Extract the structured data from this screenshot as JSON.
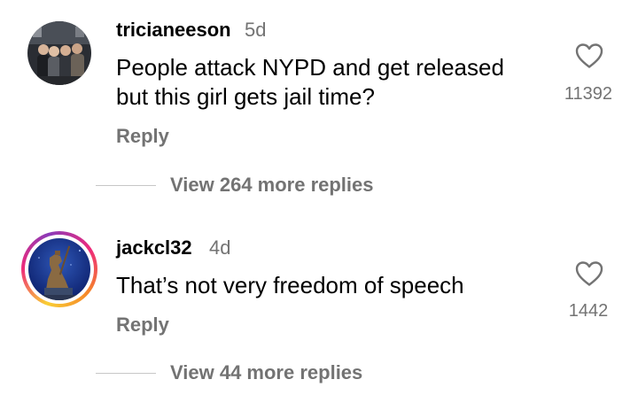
{
  "comments": [
    {
      "username": "tricianeeson",
      "time": "5d",
      "text": "People attack NYPD and get released but this girl gets jail time?",
      "reply_label": "Reply",
      "likes": "11392",
      "view_replies": "View 264 more replies",
      "avatar_icon": "group-photo-avatar",
      "has_story_ring": false
    },
    {
      "username": "jackcl32",
      "time": "4d",
      "text": "That’s not very freedom of speech",
      "reply_label": "Reply",
      "likes": "1442",
      "view_replies": "View 44 more replies",
      "avatar_icon": "statue-photo-avatar",
      "has_story_ring": true
    }
  ],
  "icons": {
    "like": "heart-outline-icon"
  },
  "colors": {
    "text_primary": "#000000",
    "text_secondary": "#737373",
    "divider": "#c7c7c7",
    "story_ring_start": "#f9ce34",
    "story_ring_mid": "#ee2a7b",
    "story_ring_end": "#8a3ab9"
  }
}
